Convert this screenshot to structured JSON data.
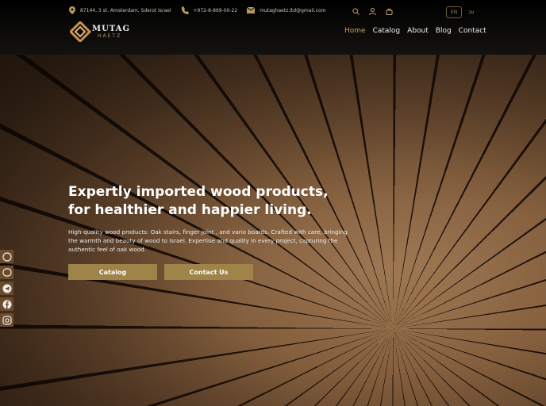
{
  "topbar": {
    "address": "87144, 3 st. Amsterdam, Sderot Israel",
    "phone": "+972-8-869-00-22",
    "email": "mutaghaetz.ltd@gmail.com"
  },
  "lang": {
    "en": "EN",
    "he": "עב"
  },
  "logo": {
    "name": "MUTAG",
    "sub": "HAETZ"
  },
  "nav": [
    "Home",
    "Catalog",
    "About",
    "Blog",
    "Contact"
  ],
  "hero": {
    "title": "Expertly imported wood products, for healthier and happier living.",
    "text": "High-quality wood products: Oak stairs, finger joint , and vario boards. Crafted with care, bringing the warmth and beauty of wood to Israel. Expertise and quality in every project, capturing the authentic feel of oak wood.",
    "catalog_label": "Catalog",
    "contact_label": "Contact Us"
  },
  "colors": {
    "accent": "#9e8448",
    "gold": "#c5a36b"
  }
}
